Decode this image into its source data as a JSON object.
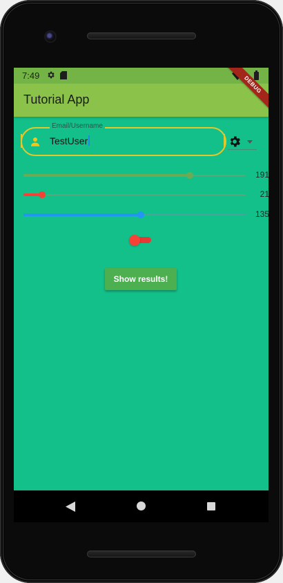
{
  "status_bar": {
    "time": "7:49",
    "icons": [
      "gear-icon",
      "sd-card-icon",
      "wifi-icon",
      "battery-icon"
    ]
  },
  "app_bar": {
    "title": "Tutorial App",
    "debug_banner": "DEBUG"
  },
  "email_field": {
    "label": "Email/Username",
    "value": "TestUser",
    "leading_icon": "person-icon",
    "border_color": "#e3c72b"
  },
  "settings_dropdown": {
    "icon": "gear-icon",
    "chevron": "chevron-down-icon"
  },
  "sliders": [
    {
      "value": 191,
      "max": 255,
      "label": "191",
      "color": "#6bab55",
      "track_color": "#5aa57a"
    },
    {
      "value": 21,
      "max": 255,
      "label": "21",
      "color": "#f44336",
      "track_color": "#5aa57a"
    },
    {
      "value": 135,
      "max": 255,
      "label": "135",
      "color": "#2196f3",
      "track_color": "#4aa39a"
    }
  ],
  "toggle": {
    "on": false,
    "color": "#f44336"
  },
  "actions": {
    "show_results_label": "Show results!"
  },
  "colors": {
    "background": "#13c08a",
    "app_bar": "#8bc34a",
    "status_bar": "#74b447",
    "button": "#4caf50"
  },
  "nav": {
    "icons": [
      "back-icon",
      "home-icon",
      "recents-icon"
    ]
  }
}
